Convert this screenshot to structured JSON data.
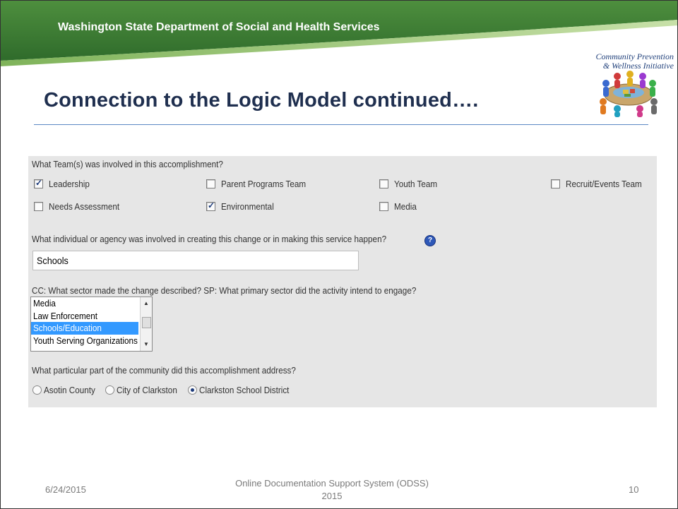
{
  "header": {
    "org_name": "Washington State Department of Social and Health Services",
    "colors": {
      "band_top": "#4a8a3a",
      "band_bottom": "#2f6a2a",
      "accent": "#9cc86b"
    }
  },
  "logo": {
    "line1": "Community Prevention",
    "line2": "& Wellness Initiative",
    "image": "people-around-table-icon"
  },
  "slide": {
    "title": "Connection to the Logic Model continued…."
  },
  "form": {
    "q_team": "What Team(s) was involved in this accomplishment?",
    "teams": [
      {
        "label": "Leadership",
        "checked": true
      },
      {
        "label": "Parent Programs Team",
        "checked": false
      },
      {
        "label": "Youth Team",
        "checked": false
      },
      {
        "label": "Recruit/Events Team",
        "checked": false
      },
      {
        "label": "Needs Assessment",
        "checked": false
      },
      {
        "label": "Environmental",
        "checked": true
      },
      {
        "label": "Media",
        "checked": false
      }
    ],
    "q_agency": "What individual or agency was involved in creating this change or in making this service happen?",
    "help_icon": "question-icon",
    "agency_value": "Schools",
    "q_sector": "CC: What sector made the change described? SP: What primary sector did the activity intend to engage?",
    "sector_options": [
      {
        "label": "Media",
        "selected": false
      },
      {
        "label": "Law Enforcement",
        "selected": false
      },
      {
        "label": "Schools/Education",
        "selected": true
      },
      {
        "label": "Youth Serving Organizations",
        "selected": false
      }
    ],
    "q_community": "What particular part of the community did this accomplishment address?",
    "community_options": [
      {
        "label": "Asotin County",
        "checked": false
      },
      {
        "label": "City of Clarkston",
        "checked": false
      },
      {
        "label": "Clarkston School District",
        "checked": true
      }
    ]
  },
  "footer": {
    "date": "6/24/2015",
    "center_line1": "Online Documentation Support System (ODSS)",
    "center_line2": "2015",
    "page": "10"
  }
}
